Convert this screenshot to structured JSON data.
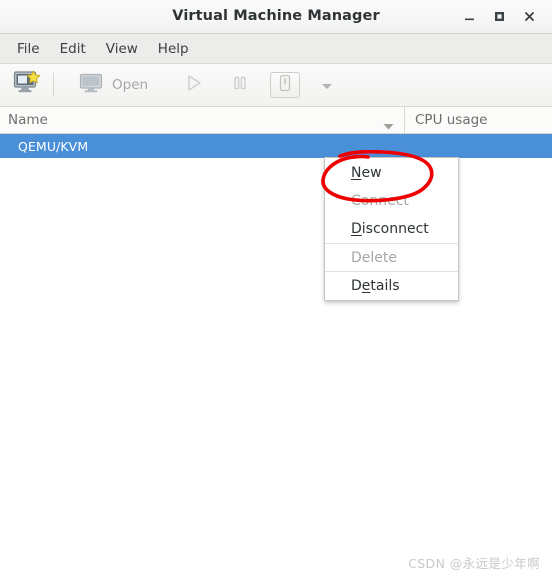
{
  "window": {
    "title": "Virtual Machine Manager",
    "controls": [
      {
        "name": "minimize",
        "glyph": "minimize-icon"
      },
      {
        "name": "maximize",
        "glyph": "maximize-icon"
      },
      {
        "name": "close",
        "glyph": "close-icon"
      }
    ]
  },
  "menubar": {
    "items": [
      {
        "label": "File"
      },
      {
        "label": "Edit"
      },
      {
        "label": "View"
      },
      {
        "label": "Help"
      }
    ]
  },
  "toolbar": {
    "new_vm_icon": "new-virtual-machine-icon",
    "open_label": "Open",
    "open_icon": "monitor-icon",
    "run_icon": "play-icon",
    "pause_icon": "pause-icon",
    "shutdown_icon": "shutdown-icon",
    "dropdown_icon": "chevron-down-icon"
  },
  "list": {
    "columns": [
      {
        "label": "Name",
        "sort_icon": "sort-descending-icon"
      },
      {
        "label": "CPU usage"
      }
    ],
    "rows": [
      {
        "name": "QEMU/KVM",
        "cpu_usage": "",
        "selected": true
      }
    ]
  },
  "context_menu": {
    "items": [
      {
        "label": "New",
        "mnemonic": "N",
        "before": "",
        "after": "ew",
        "disabled": false,
        "separator_above": false
      },
      {
        "label": "Connect",
        "mnemonic": "",
        "before": "Connect",
        "after": "",
        "disabled": true,
        "separator_above": false
      },
      {
        "label": "Disconnect",
        "mnemonic": "D",
        "before": "",
        "after": "isconnect",
        "disabled": false,
        "separator_above": false
      },
      {
        "label": "Delete",
        "mnemonic": "",
        "before": "Delete",
        "after": "",
        "disabled": true,
        "separator_above": true
      },
      {
        "label": "Details",
        "mnemonic": "e",
        "before": "D",
        "after": "tails",
        "disabled": false,
        "separator_above": true
      }
    ]
  },
  "annotation": {
    "type": "hand-drawn-ellipse",
    "color": "#ee0000",
    "targets": "New"
  },
  "watermark": {
    "text": "CSDN @永远是少年啊"
  },
  "colors": {
    "selection_blue": "#4a90d9",
    "annotation_red": "#ee0000",
    "titlebar": "#f7f7f6",
    "menubar": "#ececea",
    "toolbar": "#f5f5f3"
  }
}
